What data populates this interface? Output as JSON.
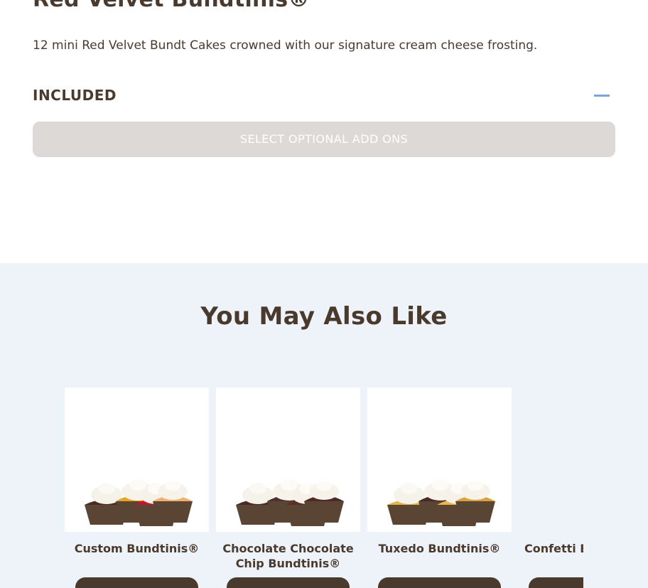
{
  "product": {
    "title": "Red Velvet Bundtinis®",
    "description": "12 mini Red Velvet Bundt Cakes crowned with our signature cream cheese frosting.",
    "included_label": "INCLUDED",
    "addons_button": "SELECT OPTIONAL ADD ONS"
  },
  "recommendations": {
    "title": "You May Also Like",
    "items": [
      {
        "name": "Custom Bundtinis®"
      },
      {
        "name": "Chocolate Chocolate Chip Bundtinis®"
      },
      {
        "name": "Tuxedo Bundtinis®"
      },
      {
        "name": "Confetti Bundtinis®"
      }
    ]
  },
  "colors": {
    "text_brown": "#4a3a2e",
    "accent_blue": "#7aa6d6",
    "section_background": "#eef2f9",
    "disabled_button": "#dcd9d7"
  }
}
